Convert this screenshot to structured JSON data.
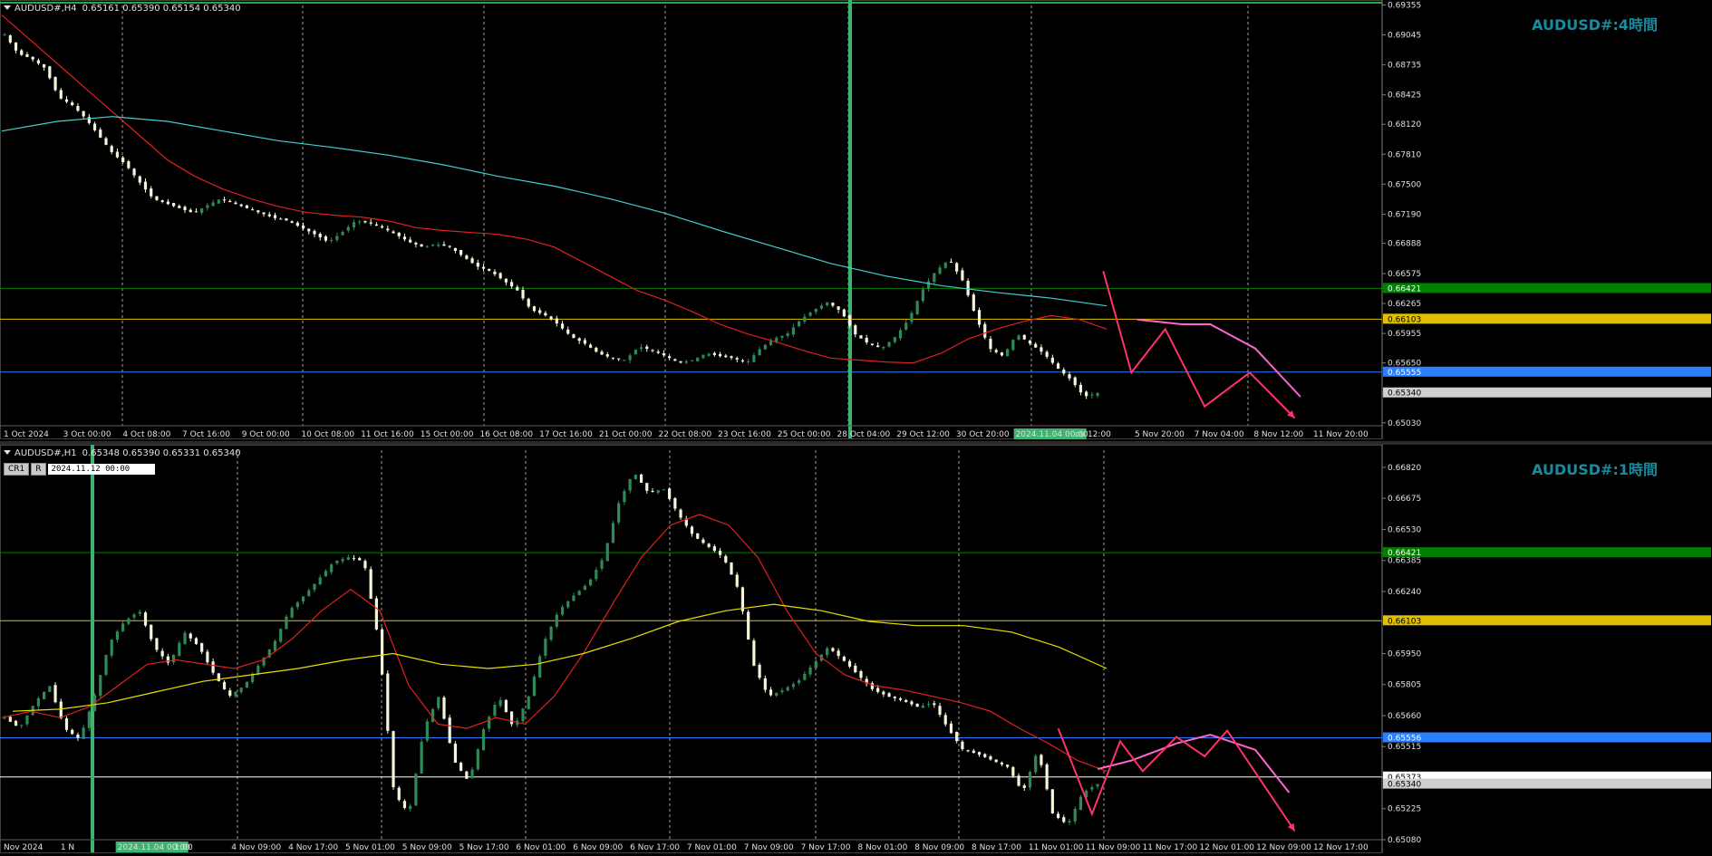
{
  "panes": {
    "h4": {
      "symbol_line": "AUDUSD#,H4",
      "ohlc": "0.65161 0.65390 0.65154 0.65340",
      "title": "AUDUSD#:4時間",
      "y_range": [
        0.65,
        0.6935
      ],
      "y_ticks": [
        "0.69355",
        "0.69045",
        "0.68735",
        "0.68425",
        "0.68120",
        "0.67810",
        "0.67500",
        "0.67190",
        "0.66888",
        "0.66575",
        "0.66265",
        "0.65955",
        "0.65650",
        "0.65340",
        "0.65030"
      ],
      "x_labels": [
        "1 Oct 2024",
        "3 Oct 00:00",
        "4 Oct 08:00",
        "7 Oct 16:00",
        "9 Oct 00:00",
        "10 Oct 08:00",
        "11 Oct 16:00",
        "15 Oct 00:00",
        "16 Oct 08:00",
        "17 Oct 16:00",
        "21 Oct 00:00",
        "22 Oct 08:00",
        "23 Oct 16:00",
        "25 Oct 00:00",
        "28 Oct 04:00",
        "29 Oct 12:00",
        "30 Oct 20:00",
        "2024.11.04 00:00",
        "ov 12:00",
        "5 Nov 20:00",
        "7 Nov 04:00",
        "8 Nov 12:00",
        "11 Nov 20:00"
      ],
      "levels": [
        {
          "name": "green",
          "value": 0.66421,
          "label": "0.66421",
          "color": "#008000"
        },
        {
          "name": "yellow",
          "value": 0.66103,
          "label": "0.66103",
          "color": "#e0c000"
        },
        {
          "name": "blue",
          "value": 0.65555,
          "label": "0.65555",
          "color": "#2a7fff"
        },
        {
          "name": "price",
          "value": 0.6534,
          "label": "0.65340",
          "color": "#d0d0d0"
        }
      ],
      "x_slots": 245,
      "price_path": [
        0.6905,
        0.6885,
        0.688,
        0.687,
        0.684,
        0.6832,
        0.6818,
        0.68,
        0.6782,
        0.677,
        0.6752,
        0.6735,
        0.673,
        0.6725,
        0.672,
        0.6728,
        0.6735,
        0.673,
        0.6725,
        0.672,
        0.6715,
        0.6712,
        0.6705,
        0.6698,
        0.669,
        0.67,
        0.6712,
        0.671,
        0.6705,
        0.6698,
        0.669,
        0.6685,
        0.6688,
        0.6685,
        0.6675,
        0.6665,
        0.666,
        0.665,
        0.664,
        0.662,
        0.6615,
        0.6605,
        0.6592,
        0.6585,
        0.6575,
        0.657,
        0.6568,
        0.6582,
        0.6578,
        0.6572,
        0.6565,
        0.6568,
        0.6575,
        0.6572,
        0.657,
        0.6565,
        0.658,
        0.659,
        0.6595,
        0.661,
        0.662,
        0.6628,
        0.6618,
        0.6595,
        0.6585,
        0.658,
        0.6592,
        0.661,
        0.664,
        0.666,
        0.6672,
        0.665,
        0.6612,
        0.658,
        0.6572,
        0.6595,
        0.6585,
        0.6575,
        0.656,
        0.6548,
        0.653,
        0.6534
      ],
      "ma_red": [
        0.6925,
        0.69,
        0.6875,
        0.685,
        0.6825,
        0.68,
        0.6775,
        0.6758,
        0.6745,
        0.6735,
        0.6727,
        0.6721,
        0.6718,
        0.6716,
        0.6712,
        0.6705,
        0.6702,
        0.67,
        0.6698,
        0.6693,
        0.6685,
        0.667,
        0.6655,
        0.664,
        0.663,
        0.6618,
        0.6605,
        0.6595,
        0.6587,
        0.6578,
        0.657,
        0.6568,
        0.6566,
        0.6565,
        0.6575,
        0.659,
        0.66,
        0.6608,
        0.6614,
        0.661,
        0.66
      ],
      "ma_cyan": [
        0.6805,
        0.6815,
        0.682,
        0.6815,
        0.6805,
        0.6795,
        0.6788,
        0.678,
        0.677,
        0.6758,
        0.6748,
        0.6735,
        0.672,
        0.6702,
        0.6685,
        0.6668,
        0.6655,
        0.6645,
        0.6638,
        0.6632,
        0.6624
      ],
      "forecast_red": [
        [
          195,
          0.666
        ],
        [
          200,
          0.6555
        ],
        [
          206,
          0.66
        ],
        [
          213,
          0.652
        ],
        [
          221,
          0.6555
        ],
        [
          229,
          0.6508
        ]
      ],
      "forecast_pink": [
        [
          201,
          0.661
        ],
        [
          209,
          0.6605
        ],
        [
          214,
          0.6605
        ],
        [
          222,
          0.658
        ],
        [
          230,
          0.653
        ]
      ]
    },
    "h1": {
      "symbol_line": "AUDUSD#,H1",
      "ohlc": "0.65348 0.65390 0.65331 0.65340",
      "title": "AUDUSD#:1時間",
      "toolbar": {
        "btn1": "CR1",
        "btn2": "R",
        "date": "2024.11.12 00:00"
      },
      "y_range": [
        0.6508,
        0.669
      ],
      "y_ticks": [
        "0.66820",
        "0.66675",
        "0.66530",
        "0.66385",
        "0.66240",
        "0.66095",
        "0.65950",
        "0.65805",
        "0.65660",
        "0.65515",
        "0.65370",
        "0.65225",
        "0.65080"
      ],
      "x_labels": [
        "Nov 2024",
        "1 N",
        "2024.11.04 00:00",
        "1:00",
        "4 Nov 09:00",
        "4 Nov 17:00",
        "5 Nov 01:00",
        "5 Nov 09:00",
        "5 Nov 17:00",
        "6 Nov 01:00",
        "6 Nov 09:00",
        "6 Nov 17:00",
        "7 Nov 01:00",
        "7 Nov 09:00",
        "7 Nov 17:00",
        "8 Nov 01:00",
        "8 Nov 09:00",
        "8 Nov 17:00",
        "11 Nov 01:00",
        "11 Nov 09:00",
        "11 Nov 17:00",
        "12 Nov 01:00",
        "12 Nov 09:00",
        "12 Nov 17:00"
      ],
      "levels": [
        {
          "name": "green",
          "value": 0.66421,
          "label": "0.66421",
          "color": "#008000"
        },
        {
          "name": "yellow",
          "value": 0.66103,
          "label": "0.66103",
          "color": "#e0c000"
        },
        {
          "name": "blue",
          "value": 0.65556,
          "label": "0.65556",
          "color": "#2a7fff"
        },
        {
          "name": "white",
          "value": 0.65373,
          "label": "0.65373",
          "color": "#ffffff"
        },
        {
          "name": "price",
          "value": 0.6534,
          "label": "0.65340",
          "color": "#d0d0d0"
        }
      ],
      "x_slots": 245,
      "price_path": [
        0.6565,
        0.656,
        0.6572,
        0.658,
        0.656,
        0.6555,
        0.6575,
        0.66,
        0.661,
        0.6615,
        0.6598,
        0.659,
        0.6605,
        0.6598,
        0.6585,
        0.6575,
        0.658,
        0.659,
        0.66,
        0.6615,
        0.6622,
        0.663,
        0.6638,
        0.664,
        0.6638,
        0.66,
        0.653,
        0.652,
        0.656,
        0.6575,
        0.6545,
        0.6535,
        0.656,
        0.6575,
        0.656,
        0.6575,
        0.66,
        0.6615,
        0.6622,
        0.6628,
        0.664,
        0.6665,
        0.668,
        0.667,
        0.6672,
        0.666,
        0.665,
        0.6645,
        0.664,
        0.6625,
        0.659,
        0.6575,
        0.6578,
        0.6582,
        0.659,
        0.6598,
        0.6592,
        0.6585,
        0.6578,
        0.6575,
        0.6573,
        0.657,
        0.6572,
        0.656,
        0.655,
        0.6548,
        0.6545,
        0.6542,
        0.653,
        0.655,
        0.652,
        0.6515,
        0.653,
        0.6534
      ],
      "ma_red": [
        0.6565,
        0.6568,
        0.6565,
        0.657,
        0.658,
        0.659,
        0.6592,
        0.659,
        0.6588,
        0.6592,
        0.6602,
        0.6615,
        0.6625,
        0.6615,
        0.658,
        0.6562,
        0.656,
        0.6565,
        0.6562,
        0.6575,
        0.6595,
        0.6618,
        0.664,
        0.6655,
        0.666,
        0.6655,
        0.664,
        0.6615,
        0.6595,
        0.6585,
        0.658,
        0.6578,
        0.6575,
        0.6572,
        0.6568,
        0.656,
        0.6553,
        0.6545,
        0.654
      ],
      "ma_yellow": [
        0.6568,
        0.6569,
        0.6572,
        0.6577,
        0.6582,
        0.6585,
        0.6588,
        0.6592,
        0.6595,
        0.659,
        0.6588,
        0.659,
        0.6595,
        0.6602,
        0.661,
        0.6615,
        0.6618,
        0.6615,
        0.661,
        0.6608,
        0.6608,
        0.6605,
        0.6598,
        0.6588
      ],
      "forecast_red": [
        [
          187,
          0.656
        ],
        [
          193,
          0.652
        ],
        [
          198,
          0.6554
        ],
        [
          202,
          0.654
        ],
        [
          208,
          0.6556
        ],
        [
          213,
          0.6547
        ],
        [
          217,
          0.6559
        ],
        [
          229,
          0.6512
        ]
      ],
      "forecast_pink": [
        [
          194,
          0.6541
        ],
        [
          200,
          0.6545
        ],
        [
          208,
          0.6553
        ],
        [
          214,
          0.6557
        ],
        [
          222,
          0.655
        ],
        [
          228,
          0.653
        ]
      ]
    }
  }
}
